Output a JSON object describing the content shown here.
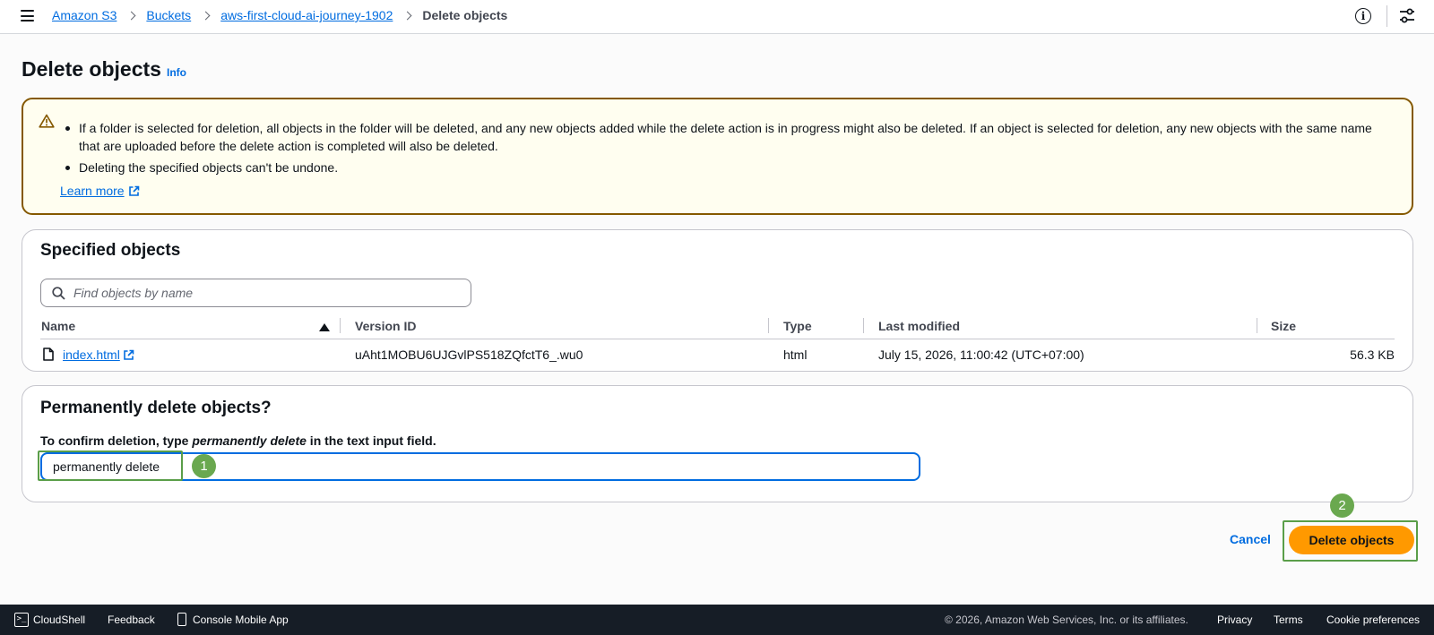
{
  "breadcrumb": {
    "items": [
      "Amazon S3",
      "Buckets",
      "aws-first-cloud-ai-journey-1902"
    ],
    "current": "Delete objects"
  },
  "header": {
    "title": "Delete objects",
    "info": "Info"
  },
  "alert": {
    "bullets": [
      "If a folder is selected for deletion, all objects in the folder will be deleted, and any new objects added while the delete action is in progress might also be deleted. If an object is selected for deletion, any new objects with the same name that are uploaded before the delete action is completed will also be deleted.",
      "Deleting the specified objects can't be undone."
    ],
    "learn_more": "Learn more"
  },
  "specified_objects": {
    "title": "Specified objects",
    "search_placeholder": "Find objects by name",
    "columns": [
      "Name",
      "Version ID",
      "Type",
      "Last modified",
      "Size"
    ],
    "rows": [
      {
        "name": "index.html",
        "version_id": "uAht1MOBU6UJGvlPS518ZQfctT6_.wu0",
        "type": "html",
        "last_modified": "July 15, 2026, 11:00:42 (UTC+07:00)",
        "size": "56.3 KB"
      }
    ]
  },
  "confirm": {
    "title": "Permanently delete objects?",
    "label_prefix": "To confirm deletion, type ",
    "label_emphasis": "permanently delete",
    "label_suffix": " in the text input field.",
    "input_value": "permanently delete"
  },
  "steps": {
    "one": "1",
    "two": "2"
  },
  "actions": {
    "cancel": "Cancel",
    "delete": "Delete objects"
  },
  "footer": {
    "cloudshell": "CloudShell",
    "feedback": "Feedback",
    "mobile_app": "Console Mobile App",
    "copyright": "© 2026, Amazon Web Services, Inc. or its affiliates.",
    "privacy": "Privacy",
    "terms": "Terms",
    "cookies": "Cookie preferences"
  },
  "colors": {
    "link": "#006ce0",
    "primary_button": "#ff9900",
    "warning_border": "#855900",
    "warning_bg": "#fffef0",
    "footer_bg": "#161d26",
    "step_marker": "#6aa84f"
  }
}
